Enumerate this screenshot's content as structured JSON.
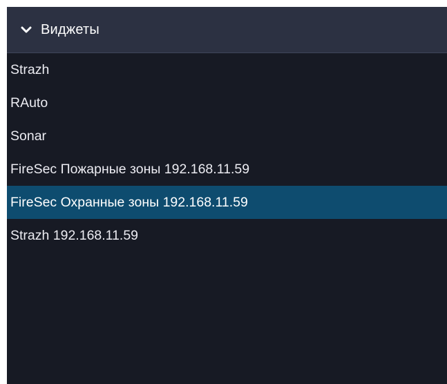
{
  "panel": {
    "title": "Виджеты",
    "expand_icon": "chevron-down-icon",
    "expanded": true
  },
  "items": [
    {
      "label": "Strazh",
      "selected": false
    },
    {
      "label": "RAuto",
      "selected": false
    },
    {
      "label": "Sonar",
      "selected": false
    },
    {
      "label": "FireSec Пожарные зоны 192.168.11.59",
      "selected": false
    },
    {
      "label": "FireSec Охранные зоны 192.168.11.59",
      "selected": true
    },
    {
      "label": "Strazh 192.168.11.59",
      "selected": false
    }
  ],
  "colors": {
    "background": "#171a24",
    "header_background": "#2c3142",
    "selected_background": "#0e4c6f",
    "text": "#ececf2"
  }
}
